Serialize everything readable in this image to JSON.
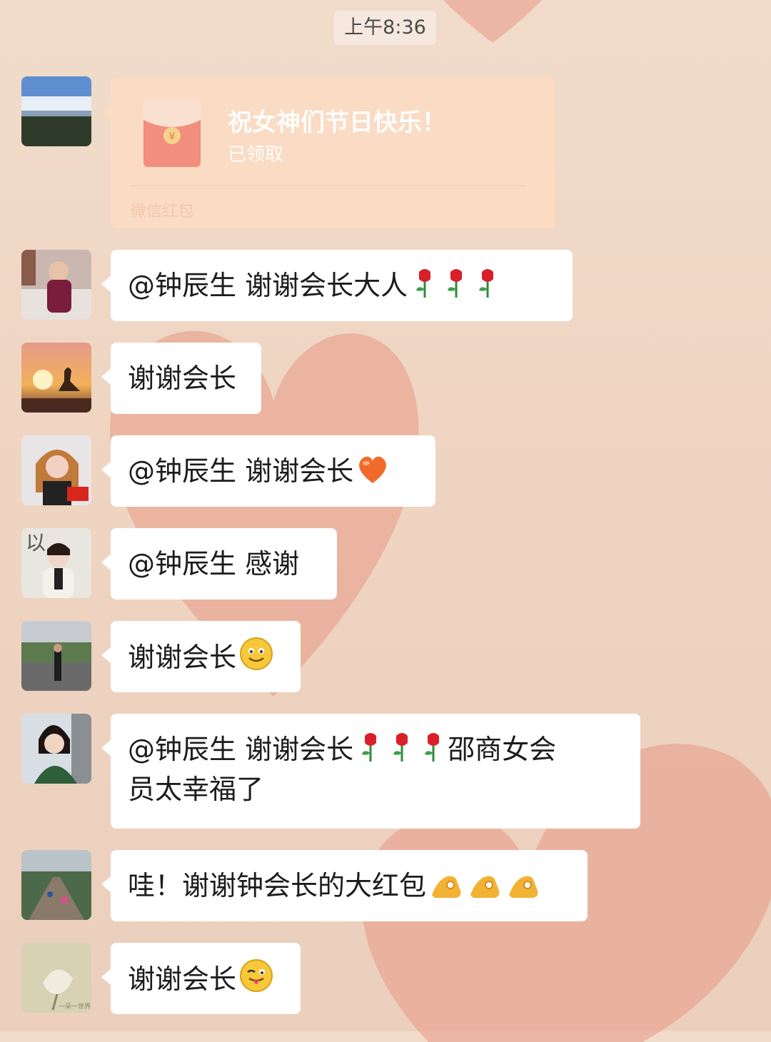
{
  "time": "上午8:36",
  "red_packet": {
    "title": "祝女神们节日快乐！",
    "status": "已领取",
    "footer": "微信红包",
    "icon": "red-envelope-icon"
  },
  "messages": [
    {
      "text": "@钟辰生  谢谢会长大人",
      "emoji": [
        "rose",
        "rose",
        "rose"
      ]
    },
    {
      "text": "谢谢会长",
      "emoji": []
    },
    {
      "text": "@钟辰生  谢谢会长",
      "emoji": [
        "orange-heart"
      ]
    },
    {
      "text": "@钟辰生  感谢",
      "emoji": []
    },
    {
      "text": "谢谢会长",
      "emoji": [
        "smile"
      ]
    },
    {
      "text_line1": "@钟辰生  谢谢会长",
      "emoji": [
        "rose",
        "rose",
        "rose"
      ],
      "text_after": "邵商女会",
      "text_line2": "员太幸福了"
    },
    {
      "text": "哇！谢谢钟会长的大红包",
      "emoji": [
        "ok-hand",
        "ok-hand",
        "ok-hand"
      ]
    },
    {
      "text": "谢谢会长",
      "emoji": [
        "tongue-wink"
      ]
    }
  ],
  "colors": {
    "background": "#efd5c2",
    "bubble": "#ffffff",
    "red_packet": "#fbdcc3",
    "heart": "#e79a86"
  }
}
